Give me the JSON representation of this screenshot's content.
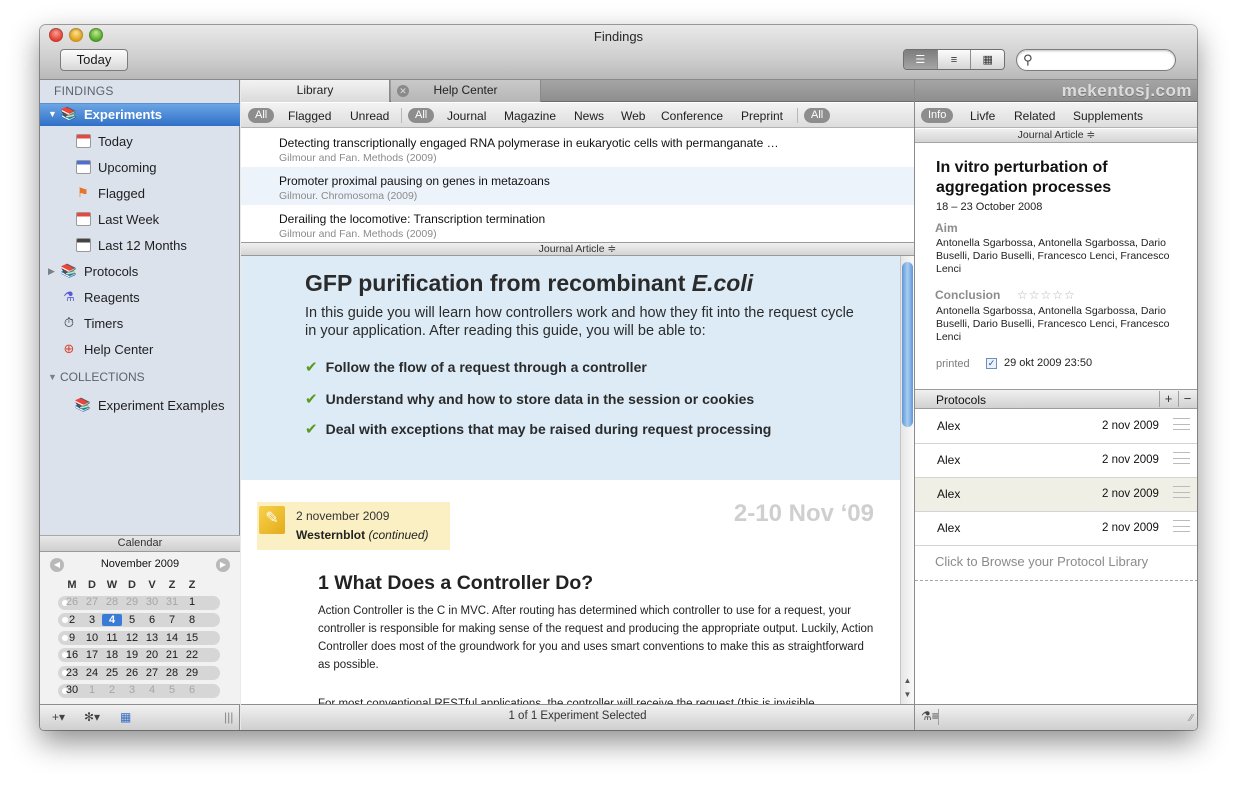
{
  "window": {
    "title": "Findings"
  },
  "toolbar": {
    "today_label": "Today",
    "view_modes": [
      "detail-list-icon",
      "list-icon",
      "grid-icon"
    ],
    "active_view": 0,
    "search_placeholder": ""
  },
  "sidebar": {
    "findings_header": "FINDINGS",
    "experiments_label": "Experiments",
    "items": [
      {
        "label": "Today",
        "icon": "calendar-today-icon"
      },
      {
        "label": "Upcoming",
        "icon": "calendar-upcoming-icon"
      },
      {
        "label": "Flagged",
        "icon": "flag-icon"
      },
      {
        "label": "Last Week",
        "icon": "calendar-week-icon"
      },
      {
        "label": "Last 12 Months",
        "icon": "calendar-year-icon"
      }
    ],
    "protocols_label": "Protocols",
    "reagents_label": "Reagents",
    "timers_label": "Timers",
    "helpcenter_label": "Help Center",
    "collections_header": "COLLECTIONS",
    "collection_item": "Experiment Examples"
  },
  "calendar": {
    "title": "Calendar",
    "month": "November 2009",
    "weekdays": [
      "M",
      "D",
      "W",
      "D",
      "V",
      "Z",
      "Z"
    ],
    "weeks": [
      [
        "26",
        "27",
        "28",
        "29",
        "30",
        "31",
        "1"
      ],
      [
        "2",
        "3",
        "4",
        "5",
        "6",
        "7",
        "8"
      ],
      [
        "9",
        "10",
        "11",
        "12",
        "13",
        "14",
        "15"
      ],
      [
        "16",
        "17",
        "18",
        "19",
        "20",
        "21",
        "22"
      ],
      [
        "23",
        "24",
        "25",
        "26",
        "27",
        "28",
        "29"
      ],
      [
        "30",
        "1",
        "2",
        "3",
        "4",
        "5",
        "6"
      ]
    ],
    "selected_day": "4"
  },
  "tabs": [
    {
      "label": "Library",
      "active": true
    },
    {
      "label": "Help Center",
      "active": false
    }
  ],
  "filters": {
    "group1": [
      "All",
      "Flagged",
      "Unread"
    ],
    "group2": [
      "All",
      "Journal",
      "Magazine",
      "News",
      "Web",
      "Conference",
      "Preprint"
    ],
    "group3": [
      "All"
    ]
  },
  "articles": [
    {
      "title": "Detecting transcriptionally engaged RNA polymerase in eukaryotic cells with permanganate …",
      "meta": "Gilmour and Fan.  Methods (2009)"
    },
    {
      "title": "Promoter proximal pausing on genes in metazoans",
      "meta": "Gilmour.  Chromosoma (2009)"
    },
    {
      "title": "Derailing the locomotive: Transcription termination",
      "meta": "Gilmour and Fan.  Methods (2009)"
    }
  ],
  "list_type_label": "Journal Article ≑",
  "document": {
    "title_plain": "GFP purification from recombinant ",
    "title_italic": "E.coli",
    "intro": "In this guide you will learn how controllers work and how they fit into the request cycle in your application. After reading this guide, you will be able to:",
    "bullets": [
      "Follow the flow of a request through a controller",
      "Understand why and how to store data in the session or cookies",
      "Deal with exceptions that may be raised during request processing"
    ],
    "note_date": "2 november 2009",
    "note_title": "Westernblot",
    "note_suffix": "(continued)",
    "date_range": "2-10 Nov ‘09",
    "section_heading": "1 What Does a Controller Do?",
    "para1": "Action Controller is the C in MVC. After routing has determined which controller to use for a request, your controller is responsible for making sense of the request and producing the appropriate output. Luckily, Action Controller does most of the groundwork for you and uses smart conventions to make this as straightforward as possible.",
    "para2": "For most conventional RESTful applications, the controller will receive the request (this is invisible"
  },
  "status": {
    "selection": "1 of 1 Experiment Selected"
  },
  "right_panel": {
    "brand": "mekentosj.com",
    "tabs": [
      "Info",
      "Livfe",
      "Related",
      "Supplements"
    ],
    "active_tab": 0,
    "type_label": "Journal Article ≑",
    "title": "In vitro perturbation of aggregation processes",
    "date": "18 – 23 October 2008",
    "aim_label": "Aim",
    "aim_text": "Antonella Sgarbossa, Antonella Sgarbossa, Dario Buselli, Dario Buselli, Francesco Lenci, Francesco Lenci",
    "conclusion_label": "Conclusion",
    "stars": "☆☆☆☆☆",
    "conclusion_text": "Antonella Sgarbossa, Antonella Sgarbossa, Dario Buselli, Dario Buselli, Francesco Lenci, Francesco Lenci",
    "printed_label": "printed",
    "printed_checked": true,
    "printed_date": "29 okt 2009 23:50",
    "protocols_label": "Protocols",
    "protocols": [
      {
        "name": "Alex",
        "date": "2 nov 2009"
      },
      {
        "name": "Alex",
        "date": "2 nov 2009"
      },
      {
        "name": "Alex",
        "date": "2 nov 2009"
      },
      {
        "name": "Alex",
        "date": "2 nov 2009"
      }
    ],
    "highlighted_protocol": 2,
    "browse_text": "Click to Browse your Protocol Library"
  }
}
